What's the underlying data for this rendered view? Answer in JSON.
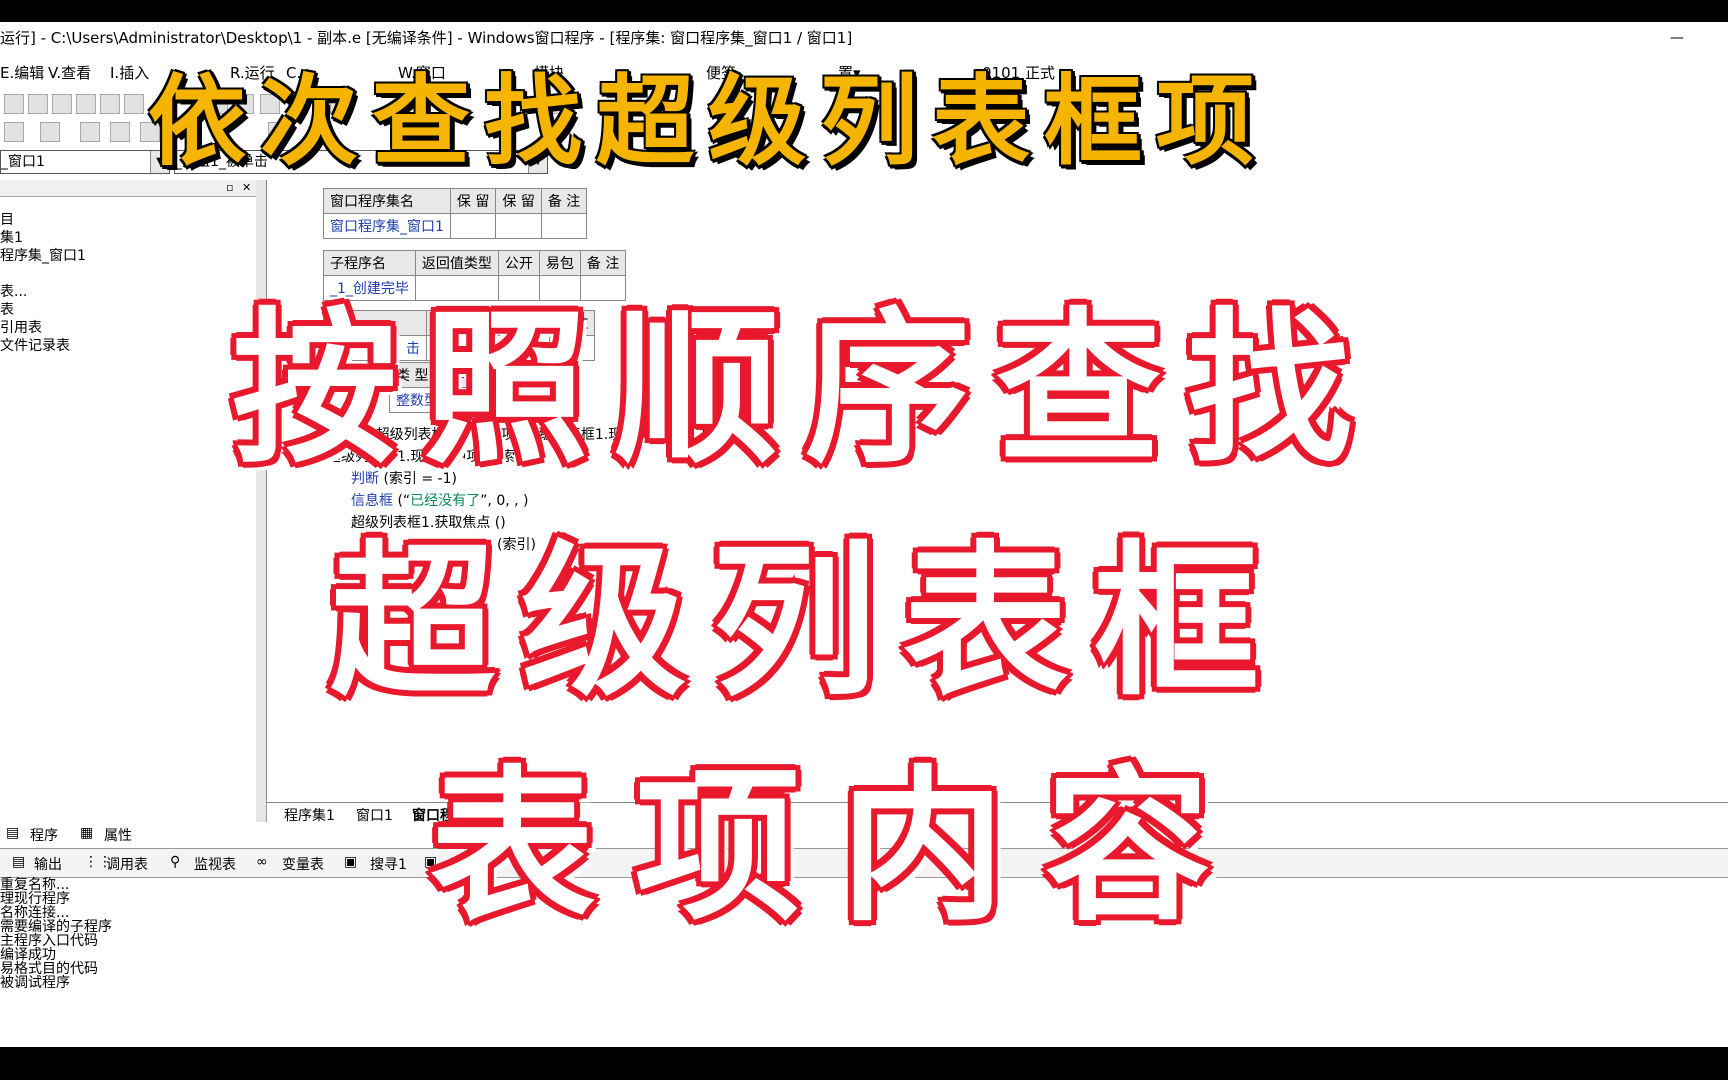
{
  "window": {
    "title": "运行] - C:\\Users\\Administrator\\Desktop\\1 - 副本.e [无编译条件] - Windows窗口程序 - [程序集: 窗口程序集_窗口1 / 窗口1]",
    "minimize": "—"
  },
  "menu": {
    "edit": "E.编辑",
    "view": "V.查看",
    "insert": "I.插入",
    "run": "R.运行",
    "compile": "C.",
    "window": "W.窗口",
    "module": "模块",
    "bookmark": "便签",
    "setting": "置▾",
    "version": "0101 正式"
  },
  "combos": {
    "left": "_窗口1",
    "right": "_按钮1_被单击"
  },
  "tree": [
    "目",
    "集1",
    "程序集_窗口1",
    "",
    "表...",
    "表",
    "引用表",
    "文件记录表"
  ],
  "assembly_table": {
    "headers": [
      "窗口程序集名",
      "保 留",
      "保 留",
      "备 注"
    ],
    "row": [
      "窗口程序集_窗口1",
      "",
      "",
      ""
    ]
  },
  "sub_table_1": {
    "headers": [
      "子程序名",
      "返回值类型",
      "公开",
      "易包",
      "备 注"
    ],
    "row": [
      "_1_创建完毕",
      "",
      "",
      "",
      ""
    ]
  },
  "sub_table_2": {
    "headers": [
      "",
      "返",
      "",
      "",
      "备 注"
    ],
    "row": [
      "击"
    ]
  },
  "var_table": {
    "headers": [
      "类 型",
      "静"
    ],
    "row": [
      "整数型"
    ]
  },
  "code": {
    "line1": "索引 = 超级列表框1.查找表项 (超级列表框1.现行选中项 + 1)",
    "line2": "超级列表框1.现行选中项 = 索引",
    "line3_kw": "判断",
    "line3": " (索引 = -1)",
    "line4_kw": "信息框",
    "line4_open": " (“",
    "line4_str": "已经没有了",
    "line4_close": "”, 0, , )",
    "line5": "超级列表框1.获取焦点 ()",
    "line6": "(索引)"
  },
  "editor_tabs": [
    "程序集1",
    "窗口1",
    "窗口程"
  ],
  "left_tabs": [
    "程序",
    "属性"
  ],
  "bottom_tabs": [
    "输出",
    "调用表",
    "监视表",
    "变量表",
    "搜寻1",
    ""
  ],
  "output_lines": [
    "重复名称...",
    "理现行程序",
    "名称连接...",
    "需要编译的子程序",
    "",
    "主程序入口代码",
    "编译成功",
    "易格式目的代码",
    "被调试程序"
  ],
  "overlay": {
    "title": "依次查找超级列表框项",
    "line1": "按照顺序查找",
    "line2": "超级列表框",
    "line3": "表项内容"
  },
  "colors": {
    "title_yellow": "#f5b400",
    "caption_red": "#e8192c",
    "code_blue": "#1f3fb0",
    "string_green": "#0a8a5a"
  }
}
